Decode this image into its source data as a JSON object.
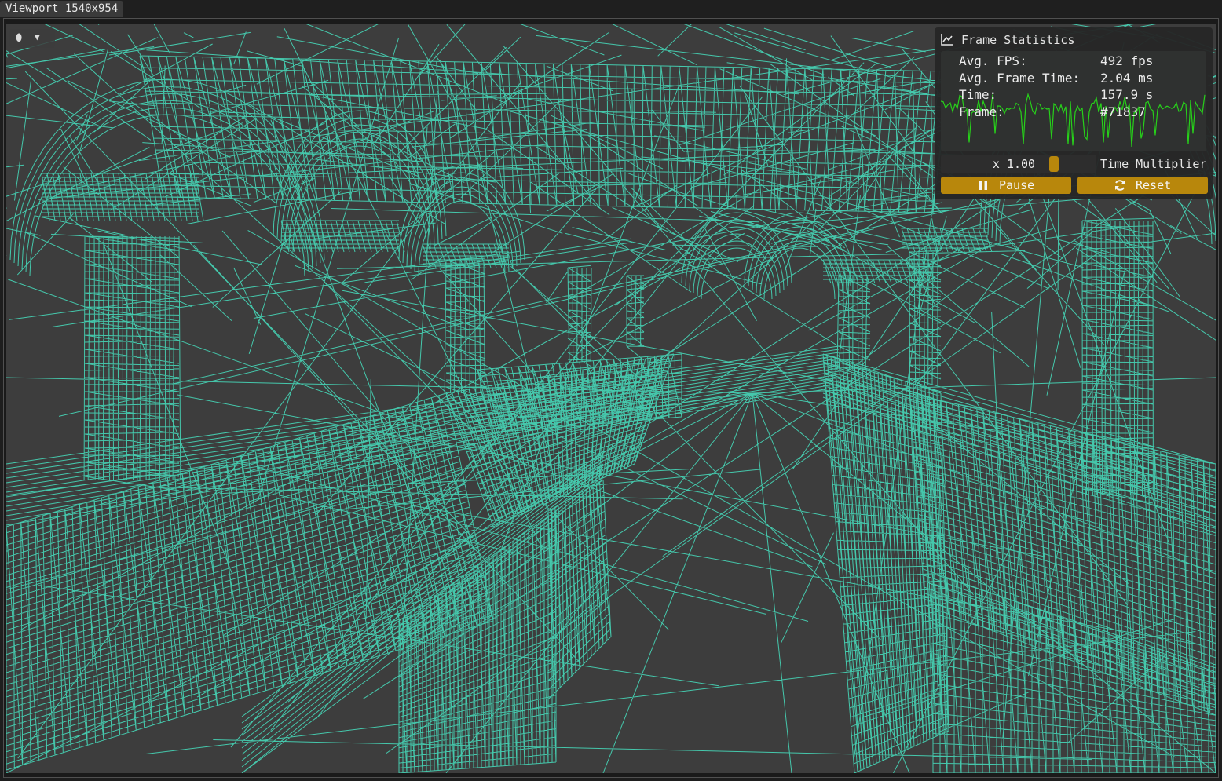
{
  "window": {
    "tab_title": "Viewport 1540x954"
  },
  "viewport": {
    "wire_color": "#45c8ac",
    "background_color": "#3d3d3d",
    "shading_icon": "shading-sphere-icon",
    "menu_icon": "chevron-down-icon"
  },
  "stats": {
    "title": "Frame Statistics",
    "title_icon": "line-chart-icon",
    "rows": [
      {
        "label": "Avg. FPS:",
        "value": "492 fps"
      },
      {
        "label": "Avg. Frame Time:",
        "value": "2.04 ms"
      },
      {
        "label": "Time:",
        "value": "157.9 s"
      },
      {
        "label": "Frame:",
        "value": "#71837"
      }
    ],
    "multiplier_value": "x 1.00",
    "multiplier_label": "Time Multiplier",
    "pause_label": "Pause",
    "pause_icon": "pause-icon",
    "reset_label": "Reset",
    "reset_icon": "refresh-icon",
    "accent_color": "#b8870c",
    "graph_color": "#27d11a"
  }
}
